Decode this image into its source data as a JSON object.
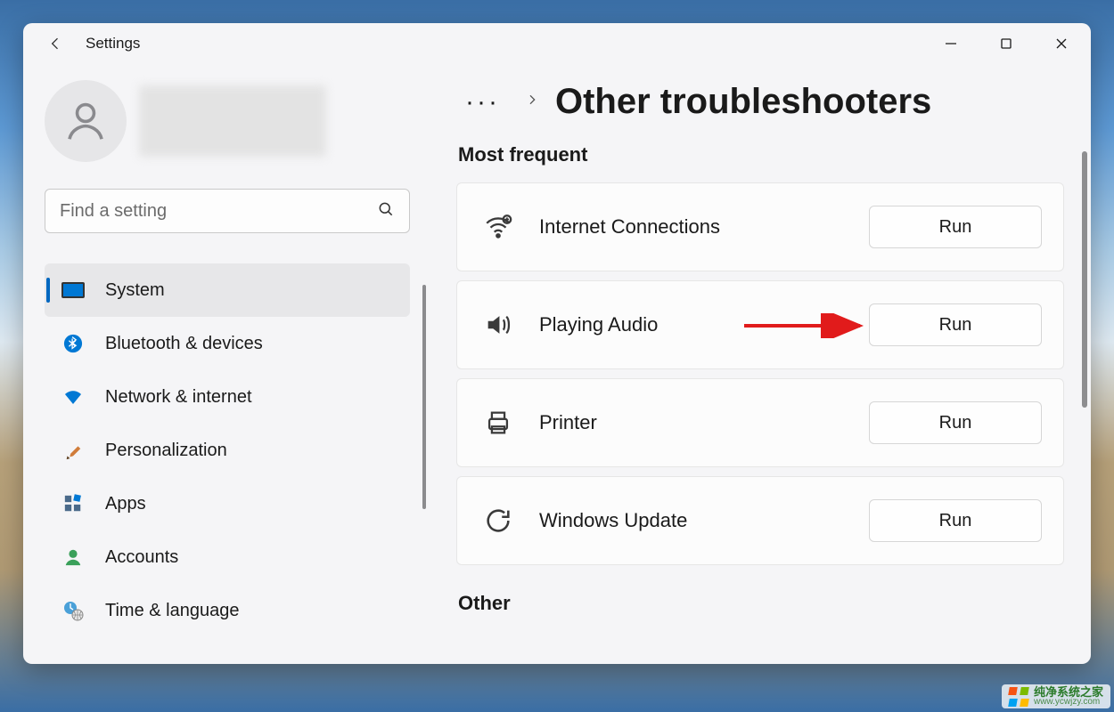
{
  "app": {
    "title": "Settings"
  },
  "search": {
    "placeholder": "Find a setting"
  },
  "sidebar": {
    "items": [
      {
        "label": "System",
        "active": true,
        "icon": "system"
      },
      {
        "label": "Bluetooth & devices",
        "active": false,
        "icon": "bluetooth"
      },
      {
        "label": "Network & internet",
        "active": false,
        "icon": "wifi"
      },
      {
        "label": "Personalization",
        "active": false,
        "icon": "brush"
      },
      {
        "label": "Apps",
        "active": false,
        "icon": "apps"
      },
      {
        "label": "Accounts",
        "active": false,
        "icon": "account"
      },
      {
        "label": "Time & language",
        "active": false,
        "icon": "clock-globe"
      }
    ]
  },
  "breadcrumb": {
    "overflow_label": "More",
    "page_title": "Other troubleshooters"
  },
  "sections": {
    "most_frequent": {
      "heading": "Most frequent",
      "items": [
        {
          "icon": "wifi",
          "label": "Internet Connections",
          "action": "Run"
        },
        {
          "icon": "audio",
          "label": "Playing Audio",
          "action": "Run",
          "highlighted": true
        },
        {
          "icon": "printer",
          "label": "Printer",
          "action": "Run"
        },
        {
          "icon": "update",
          "label": "Windows Update",
          "action": "Run"
        }
      ]
    },
    "other": {
      "heading": "Other"
    }
  },
  "annotation": {
    "arrow_color": "#e11b1b"
  },
  "watermark": {
    "line1": "纯净系统之家",
    "line2": "www.ycwjzy.com"
  }
}
